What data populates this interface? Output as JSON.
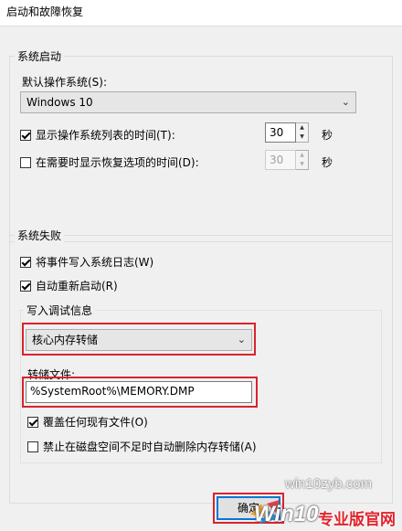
{
  "window": {
    "title": "启动和故障恢复"
  },
  "system_startup": {
    "group_label": "系统启动",
    "default_os_label": "默认操作系统(S):",
    "default_os_value": "Windows 10",
    "show_os_list": {
      "label": "显示操作系统列表的时间(T):",
      "checked": true,
      "value": "30",
      "unit": "秒"
    },
    "show_recovery": {
      "label": "在需要时显示恢复选项的时间(D):",
      "checked": false,
      "value": "30",
      "unit": "秒"
    }
  },
  "system_failure": {
    "group_label": "系统失败",
    "write_event": {
      "label": "将事件写入系统日志(W)",
      "checked": true
    },
    "auto_restart": {
      "label": "自动重新启动(R)",
      "checked": true
    },
    "debug_info": {
      "group_label": "写入调试信息",
      "dump_type": "核心内存转储",
      "dump_file_label": "转储文件:",
      "dump_file_value": "%SystemRoot%\\MEMORY.DMP",
      "overwrite": {
        "label": "覆盖任何现有文件(O)",
        "checked": true
      },
      "disable_auto_delete": {
        "label": "禁止在磁盘空间不足时自动删除内存转储(A)",
        "checked": false
      }
    }
  },
  "buttons": {
    "ok": "确定"
  },
  "watermark": {
    "url": "win10zyb.com",
    "brand": "Win10",
    "slogan": "专业版官网"
  },
  "colors": {
    "highlight": "#d9232d",
    "accent": "#0078d7",
    "watermark_red": "#e0242c"
  }
}
